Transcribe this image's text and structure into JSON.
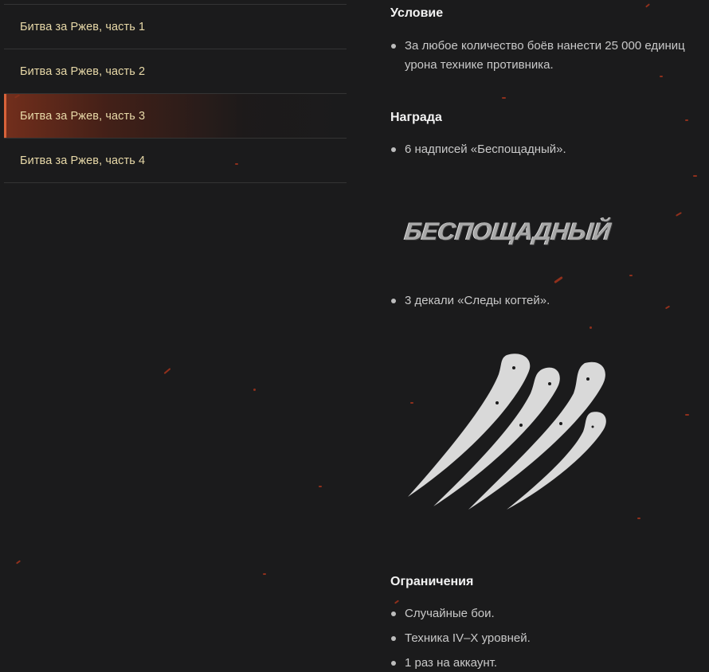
{
  "sidebar": {
    "items": [
      {
        "label": "Битва за Ржев, часть 1",
        "active": false
      },
      {
        "label": "Битва за Ржев, часть 2",
        "active": false
      },
      {
        "label": "Битва за Ржев, часть 3",
        "active": true
      },
      {
        "label": "Битва за Ржев, часть 4",
        "active": false
      }
    ]
  },
  "content": {
    "condition": {
      "heading": "Условие",
      "items": [
        "За любое количество боёв нанести 25 000 единиц\nурона технике противника."
      ]
    },
    "reward": {
      "heading": "Награда",
      "items": [
        "6 надписей «Беспощадный».",
        "3 декали «Следы когтей»."
      ],
      "inscription_text": "БЕСПОЩАДНЫЙ",
      "decal_icon": "claw-marks-icon"
    },
    "restrictions": {
      "heading": "Ограничения",
      "items": [
        "Случайные бои.",
        "Техника IV–X уровней.",
        "1 раз на аккаунт."
      ]
    }
  },
  "colors": {
    "background": "#1b1b1c",
    "sidebar_text": "#e8d9a8",
    "active_accent": "#d8633a",
    "heading": "#f2f2f2",
    "body_text": "#c9c9c9"
  }
}
